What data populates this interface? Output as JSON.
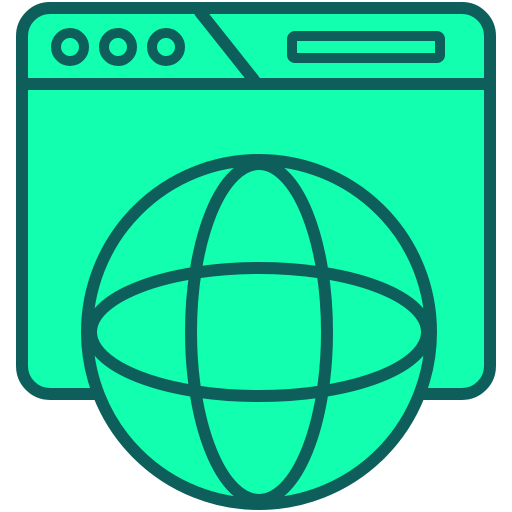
{
  "icon": {
    "name": "web-browser-globe-icon",
    "browser_window": {
      "icon": "browser-window-icon",
      "control_dots": [
        "window-dot-icon",
        "window-dot-icon",
        "window-dot-icon"
      ],
      "address_bar": "address-bar-icon"
    },
    "globe": {
      "icon": "globe-icon"
    }
  },
  "colors": {
    "fill": "#12FFAF",
    "stroke": "#0E5E5B",
    "background": "#FFFFFF"
  }
}
